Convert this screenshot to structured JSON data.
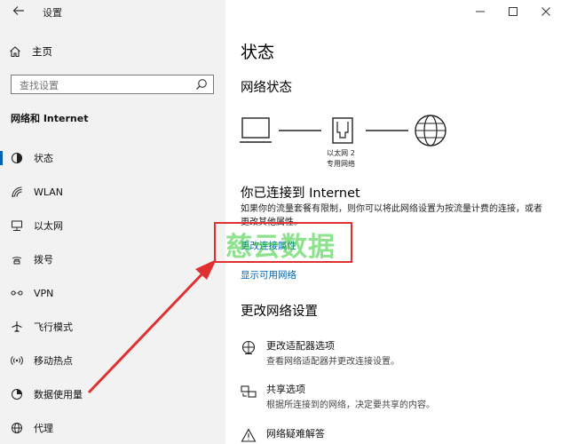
{
  "window": {
    "title": "设置"
  },
  "sidebar": {
    "home_label": "主页",
    "search_placeholder": "查找设置",
    "section_title": "网络和 Internet",
    "items": [
      {
        "label": "状态",
        "icon": "status-icon",
        "active": true
      },
      {
        "label": "WLAN",
        "icon": "wifi-icon"
      },
      {
        "label": "以太网",
        "icon": "ethernet-icon"
      },
      {
        "label": "拨号",
        "icon": "dialup-icon"
      },
      {
        "label": "VPN",
        "icon": "vpn-icon"
      },
      {
        "label": "飞行模式",
        "icon": "airplane-icon"
      },
      {
        "label": "移动热点",
        "icon": "hotspot-icon"
      },
      {
        "label": "数据使用量",
        "icon": "data-usage-icon"
      },
      {
        "label": "代理",
        "icon": "globe-icon"
      }
    ]
  },
  "main": {
    "title": "状态",
    "network_status_heading": "网络状态",
    "adapter_name": "以太网 2",
    "network_type": "专用网络",
    "connected_heading": "你已连接到 Internet",
    "description": "如果你的流量套餐有限制，则你可以将此网络设置为按流量计费的连接，或者更改其他属性。",
    "change_props_link": "更改连接属性",
    "show_networks_link": "显示可用网络",
    "change_settings_heading": "更改网络设置",
    "options": [
      {
        "title": "更改适配器选项",
        "subtitle": "查看网络适配器并更改连接设置。",
        "icon": "adapter-icon"
      },
      {
        "title": "共享选项",
        "subtitle": "根据所连接到的网络，决定要共享的内容。",
        "icon": "sharing-icon"
      },
      {
        "title": "网络疑难解答",
        "subtitle": "",
        "icon": "troubleshoot-icon"
      }
    ]
  },
  "watermark": "慈云数据",
  "colors": {
    "accent": "#0063b1",
    "highlight": "#e03030",
    "arrow": "#e03030",
    "watermark": "#33cc33"
  }
}
